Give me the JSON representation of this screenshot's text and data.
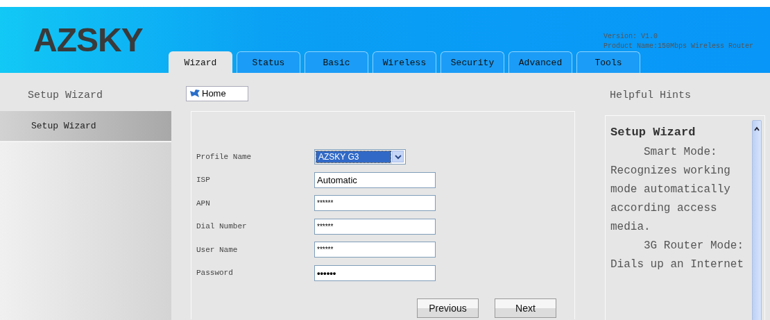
{
  "header": {
    "logo": "AZSKY",
    "version": "Version: V1.0",
    "product_name": "Product Name:150Mbps Wireless Router"
  },
  "tabs": [
    {
      "label": "Wizard",
      "selected": true
    },
    {
      "label": "Status",
      "selected": false
    },
    {
      "label": "Basic",
      "selected": false
    },
    {
      "label": "Wireless",
      "selected": false
    },
    {
      "label": "Security",
      "selected": false
    },
    {
      "label": "Advanced",
      "selected": false
    },
    {
      "label": "Tools",
      "selected": false
    }
  ],
  "sidebar": {
    "title": "Setup Wizard",
    "items": [
      {
        "label": "Setup Wizard",
        "selected": true
      }
    ]
  },
  "home_button": "Home",
  "form": {
    "fields": [
      {
        "label": "Profile Name",
        "kind": "select",
        "value": "AZSKY G3"
      },
      {
        "label": "ISP",
        "kind": "text",
        "value": "Automatic"
      },
      {
        "label": "APN",
        "kind": "text",
        "value": "******"
      },
      {
        "label": "Dial Number",
        "kind": "text",
        "value": "******"
      },
      {
        "label": "User Name",
        "kind": "text",
        "value": "******"
      },
      {
        "label": "Password",
        "kind": "password",
        "value": "••••••"
      }
    ],
    "buttons": [
      "Previous",
      "Next"
    ]
  },
  "hints": {
    "title": "Helpful Hints",
    "heading": "Setup Wizard",
    "paragraphs": [
      "Smart Mode: Recognizes working mode automatically according access media.",
      "3G Router Mode: Dials up an Internet"
    ]
  }
}
